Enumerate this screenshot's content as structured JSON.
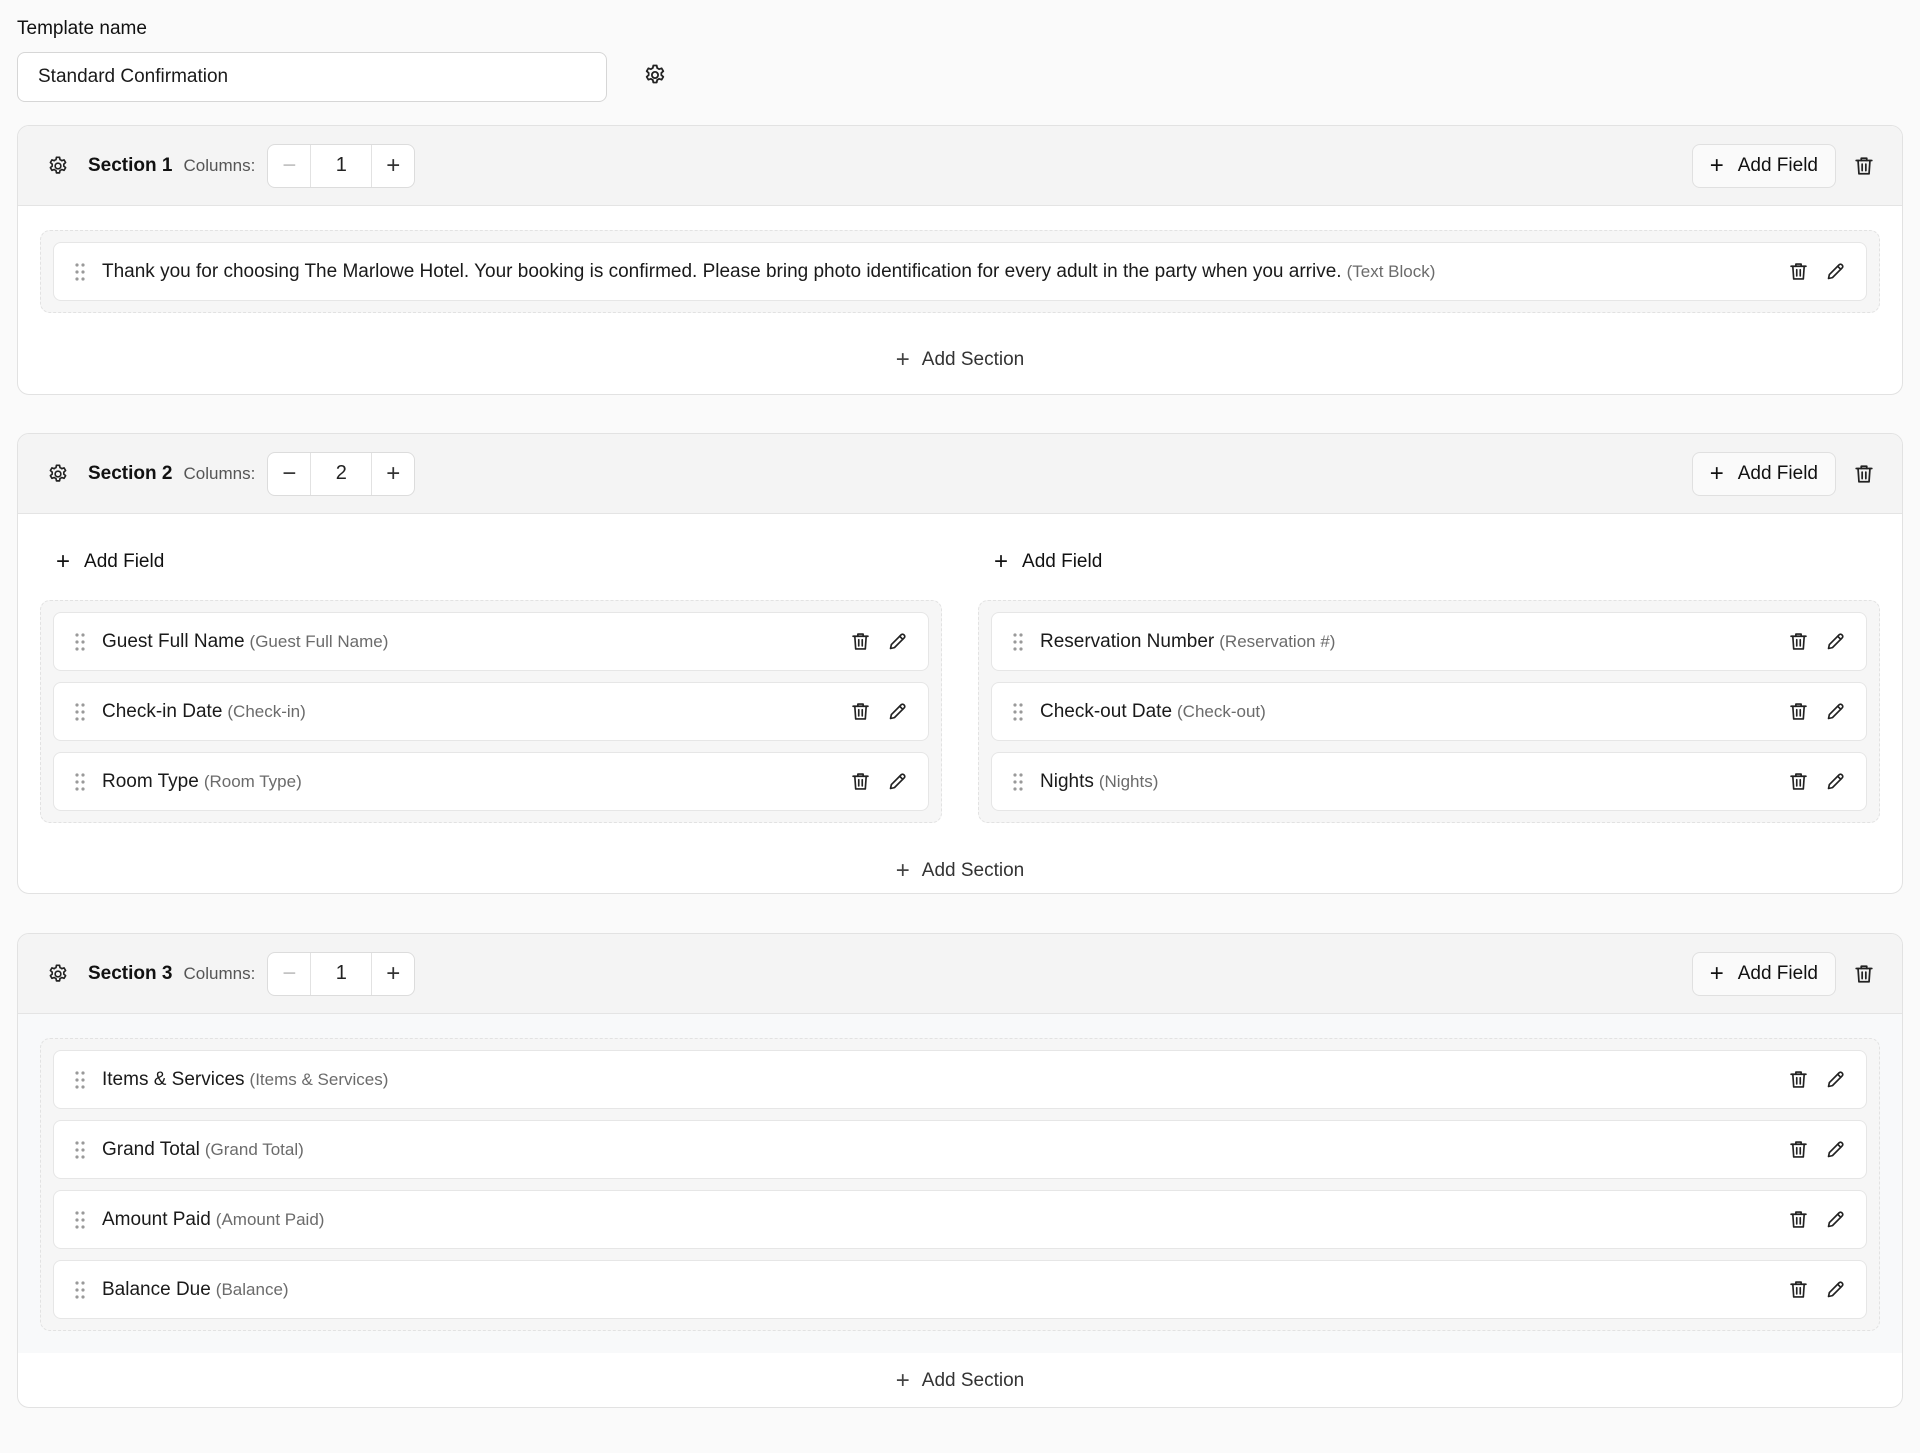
{
  "template": {
    "label": "Template name",
    "name_value": "Standard Confirmation"
  },
  "labels": {
    "columns": "Columns:",
    "add_field": "Add Field",
    "add_section": "Add Section"
  },
  "sections": [
    {
      "title": "Section 1",
      "columns": "1",
      "fields": [
        {
          "label": "Thank you for choosing The Marlowe Hotel. Your booking is confirmed. Please bring photo identification for every adult in the party when you arrive.",
          "alias": "(Text Block)"
        }
      ]
    },
    {
      "title": "Section 2",
      "columns": "2",
      "column_fields": [
        [
          {
            "label": "Guest Full Name",
            "alias": "(Guest Full Name)"
          },
          {
            "label": "Check-in Date",
            "alias": "(Check-in)"
          },
          {
            "label": "Room Type",
            "alias": "(Room Type)"
          }
        ],
        [
          {
            "label": "Reservation Number",
            "alias": "(Reservation #)"
          },
          {
            "label": "Check-out Date",
            "alias": "(Check-out)"
          },
          {
            "label": "Nights",
            "alias": "(Nights)"
          }
        ]
      ]
    },
    {
      "title": "Section 3",
      "columns": "1",
      "fields": [
        {
          "label": "Items & Services",
          "alias": "(Items & Services)"
        },
        {
          "label": "Grand Total",
          "alias": "(Grand Total)"
        },
        {
          "label": "Amount Paid",
          "alias": "(Amount Paid)"
        },
        {
          "label": "Balance Due",
          "alias": "(Balance)"
        }
      ]
    }
  ],
  "icons": {
    "settings": "gear-icon",
    "delete": "trash-icon",
    "edit": "pencil-icon",
    "drag": "drag-handle-icon",
    "add": "plus-icon",
    "decrement": "minus-icon"
  }
}
